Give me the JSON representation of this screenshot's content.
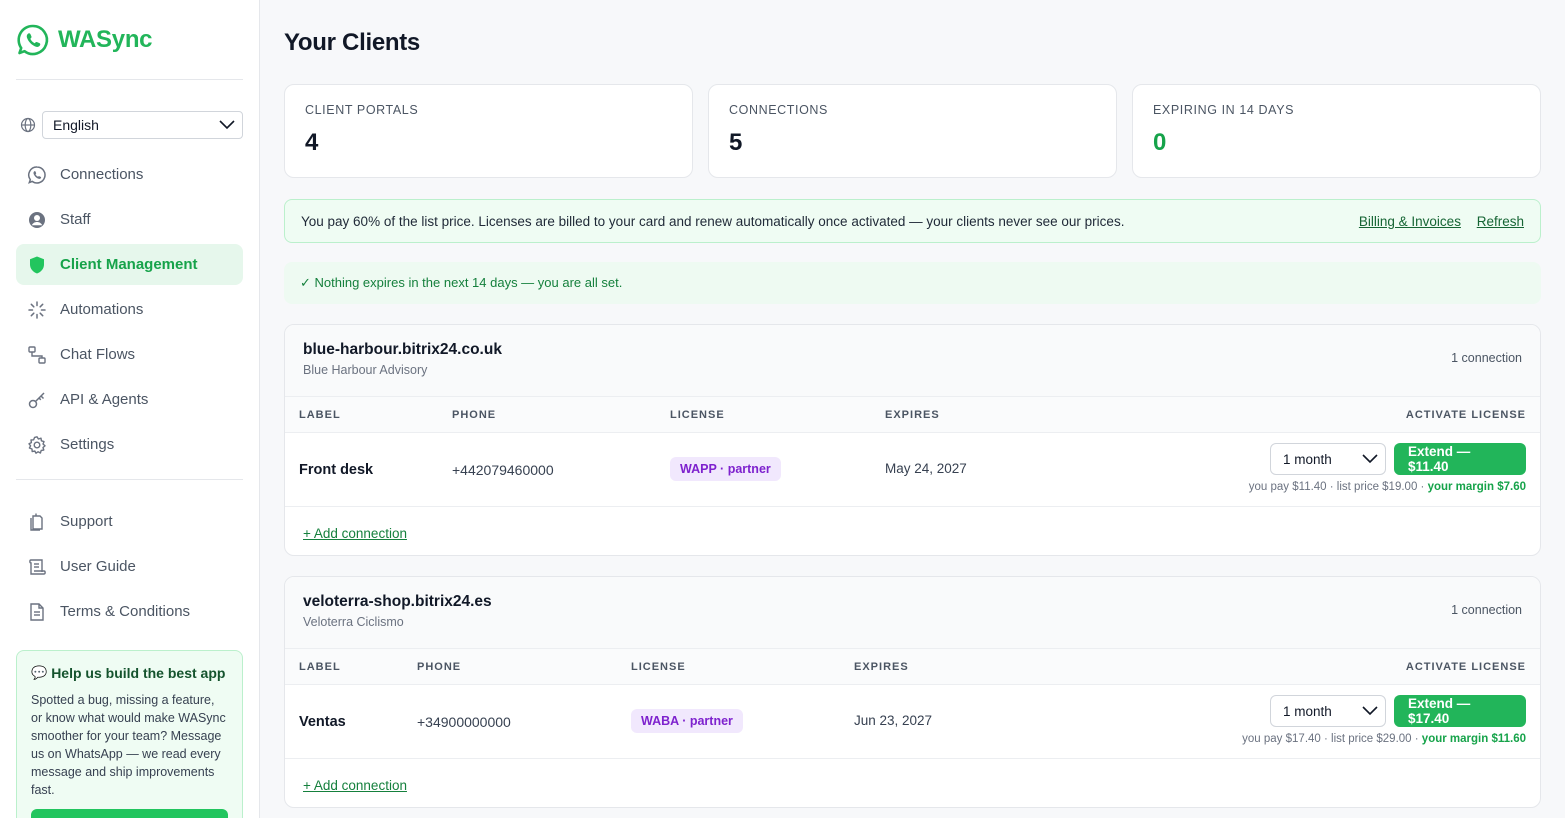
{
  "brand": {
    "name": "WASync",
    "color": "#22b55a"
  },
  "language": {
    "selected": "English"
  },
  "nav": {
    "items": [
      {
        "label": "Connections",
        "icon": "whatsapp-icon"
      },
      {
        "label": "Staff",
        "icon": "user-icon"
      },
      {
        "label": "Client Management",
        "icon": "shield-icon",
        "active": true
      },
      {
        "label": "Automations",
        "icon": "spinner-icon"
      },
      {
        "label": "Chat Flows",
        "icon": "flow-icon"
      },
      {
        "label": "API & Agents",
        "icon": "key-icon"
      },
      {
        "label": "Settings",
        "icon": "gear-icon"
      }
    ],
    "secondary": [
      {
        "label": "Support",
        "icon": "support-icon"
      },
      {
        "label": "User Guide",
        "icon": "scroll-icon"
      },
      {
        "label": "Terms & Conditions",
        "icon": "document-icon"
      }
    ]
  },
  "feedback": {
    "icon": "💬",
    "title": "Help us build the best app",
    "text": "Spotted a bug, missing a feature, or know what would make WASync smoother for your team? Message us on WhatsApp — we read every message and ship improvements fast."
  },
  "page": {
    "title": "Your Clients"
  },
  "stats": [
    {
      "label": "CLIENT PORTALS",
      "value": "4"
    },
    {
      "label": "CONNECTIONS",
      "value": "5"
    },
    {
      "label": "EXPIRING IN 14 DAYS",
      "value": "0"
    }
  ],
  "notice": {
    "text": "You pay 60% of the list price. Licenses are billed to your card and renew automatically once activated — your clients never see our prices.",
    "billing_link": "Billing & Invoices",
    "refresh_link": "Refresh"
  },
  "ok_banner": "✓ Nothing expires in the next 14 days — you are all set.",
  "columns": {
    "label": "LABEL",
    "phone": "PHONE",
    "license": "LICENSE",
    "expires": "EXPIRES",
    "activate": "ACTIVATE LICENSE"
  },
  "portals": [
    {
      "domain": "blue-harbour.bitrix24.co.uk",
      "company": "Blue Harbour Advisory",
      "count": "1 connection",
      "row": {
        "label": "Front desk",
        "phone": "+442079460000",
        "license": "WAPP · partner",
        "expires": "May 24, 2027",
        "term": "1 month",
        "extend": "Extend — $11.40",
        "you_pay": "you pay $11.40 · list price $19.00 · ",
        "margin": "your margin $7.60"
      },
      "add": "+ Add connection"
    },
    {
      "domain": "veloterra-shop.bitrix24.es",
      "company": "Veloterra Ciclismo",
      "count": "1 connection",
      "row": {
        "label": "Ventas",
        "phone": "+34900000000",
        "license": "WABA · partner",
        "expires": "Jun 23, 2027",
        "term": "1 month",
        "extend": "Extend — $17.40",
        "you_pay": "you pay $17.40 · list price $29.00 · ",
        "margin": "your margin $11.60"
      },
      "add": "+ Add connection"
    }
  ]
}
